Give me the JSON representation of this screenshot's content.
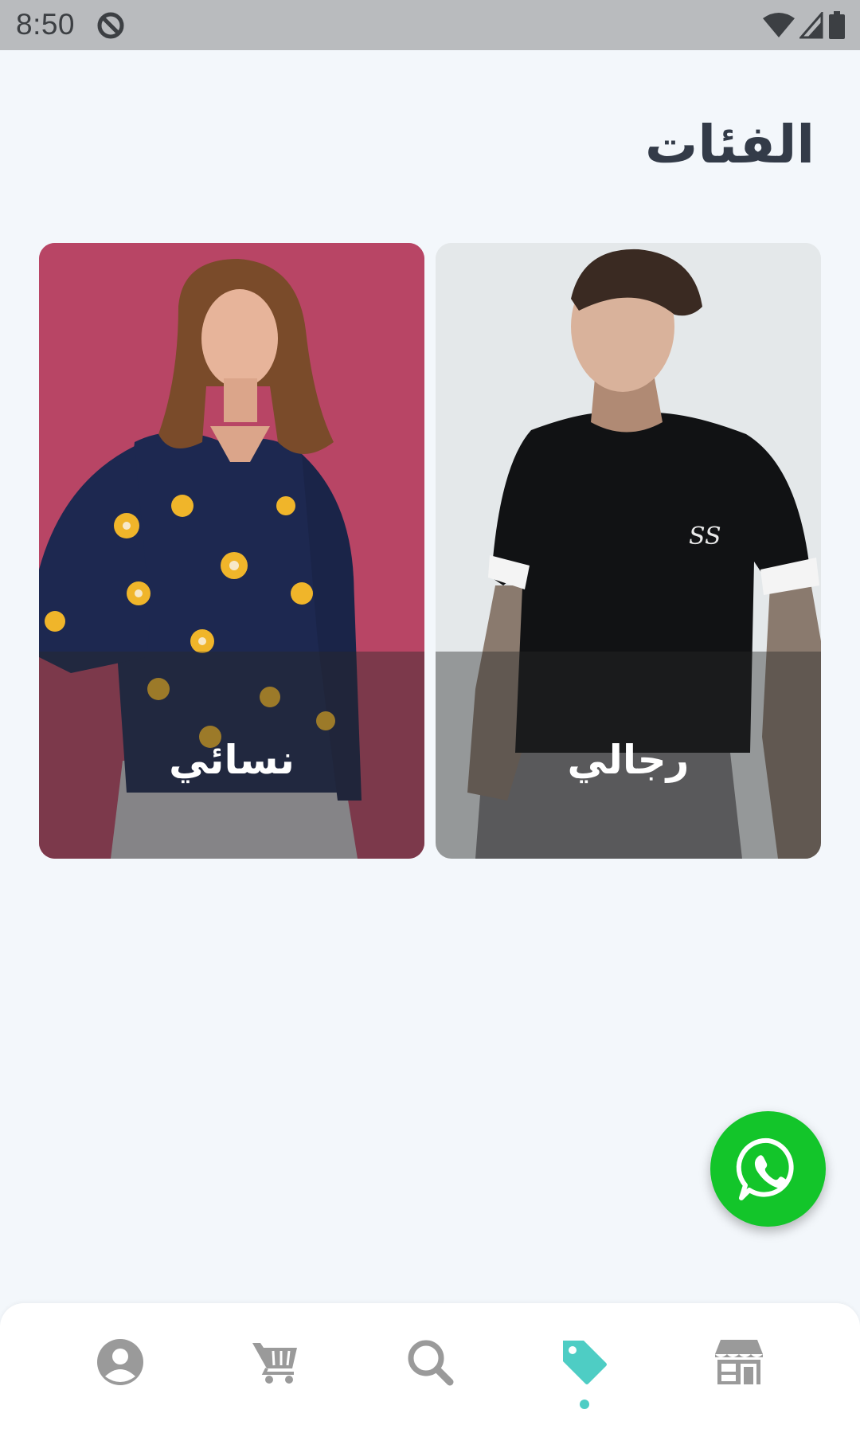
{
  "status_bar": {
    "time": "8:50",
    "icons": [
      "sync-disabled-icon",
      "wifi-icon",
      "signal-icon",
      "battery-icon"
    ]
  },
  "page": {
    "title": "الفئات"
  },
  "categories": [
    {
      "label": "نسائي",
      "image": "woman-floral-shirt-photo"
    },
    {
      "label": "رجالي",
      "image": "man-black-tshirt-photo"
    }
  ],
  "fab": {
    "icon": "whatsapp-icon",
    "color": "#13c52a"
  },
  "bottom_nav": {
    "accent_color": "#4ecdc4",
    "inactive_color": "#9a9a9a",
    "items": [
      {
        "icon": "account-icon",
        "active": false
      },
      {
        "icon": "cart-icon",
        "active": false
      },
      {
        "icon": "search-icon",
        "active": false
      },
      {
        "icon": "tag-icon",
        "active": true
      },
      {
        "icon": "store-icon",
        "active": false
      }
    ]
  }
}
